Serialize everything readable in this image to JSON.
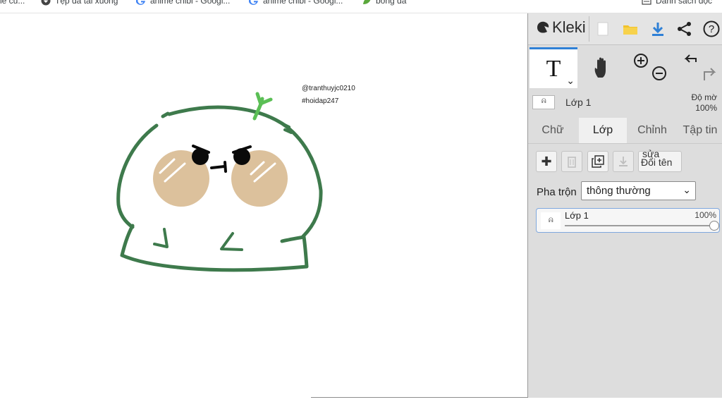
{
  "bookmarks": [
    {
      "label": "ne cu...",
      "icon": "page-icon"
    },
    {
      "label": "Tệp đã tải xuống",
      "icon": "download-globe-icon"
    },
    {
      "label": "anime chibi - Googl...",
      "icon": "google-icon"
    },
    {
      "label": "anime chibi - Googl...",
      "icon": "google-icon"
    },
    {
      "label": "bóng đá",
      "icon": "leaf-icon"
    },
    {
      "label": "Danh sách đọc",
      "icon": "reading-list-icon"
    }
  ],
  "canvas": {
    "credit_user": "@tranthuyjc0210",
    "credit_tag": "#hoidap247"
  },
  "app": {
    "logo_text": "Kleki",
    "top_icons": [
      "new-page-icon",
      "folder-icon",
      "download-icon",
      "share-icon",
      "help-icon"
    ]
  },
  "tools": {
    "active": "text-tool",
    "text_glyph": "T",
    "items": [
      "text-tool-icon",
      "hand-icon",
      "zoom-icon",
      "undo-redo-icon"
    ]
  },
  "current_layer": {
    "name": "Lớp 1",
    "opacity_label_line1": "Độ mờ",
    "opacity_value": "100%"
  },
  "tabs": [
    {
      "label": "Chữ",
      "active": false
    },
    {
      "label": "Lớp",
      "active": true
    },
    {
      "label": "Chỉnh",
      "active": false
    },
    {
      "label": "Tập tin",
      "active": false
    }
  ],
  "layers_panel": {
    "rename_line1": "sửa",
    "rename_line2": "Đổi tên",
    "blend_label": "Pha trộn",
    "blend_value": "thông thường",
    "layer": {
      "name": "Lớp 1",
      "opacity": "100%",
      "opacity_fraction": 1.0
    }
  },
  "colors": {
    "accent_blue": "#2f80d6",
    "panel_bg": "#dddddd",
    "drawing_green": "#3e7a4c",
    "sprout_green": "#5bbf55",
    "cheek_tan": "#dcc19c"
  }
}
